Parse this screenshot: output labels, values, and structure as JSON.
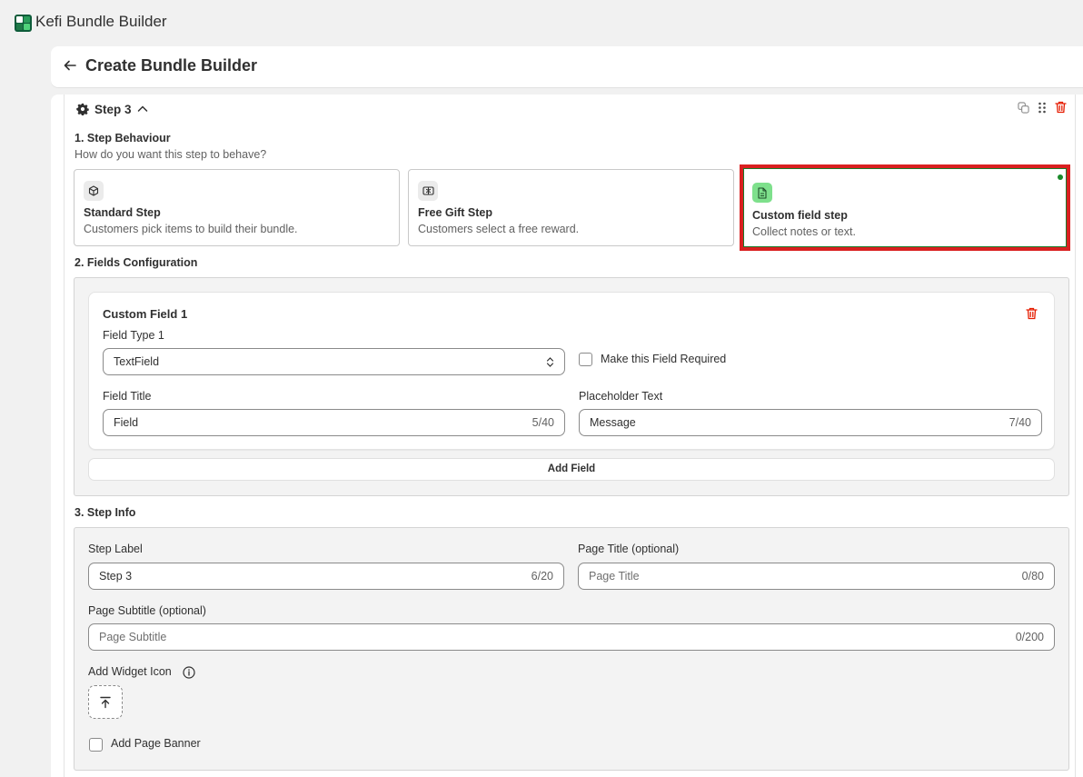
{
  "app": {
    "name": "Kefi Bundle Builder"
  },
  "header": {
    "title": "Create Bundle Builder"
  },
  "step": {
    "label": "Step 3",
    "behaviour": {
      "title": "1. Step Behaviour",
      "subtitle": "How do you want this step to behave?",
      "options": [
        {
          "title": "Standard Step",
          "desc": "Customers pick items to build their bundle.",
          "icon": "cube-icon"
        },
        {
          "title": "Free Gift Step",
          "desc": "Customers select a free reward.",
          "icon": "gift-icon"
        },
        {
          "title": "Custom field step",
          "desc": "Collect notes or text.",
          "icon": "document-icon",
          "selected": true
        }
      ]
    },
    "fields": {
      "title": "2. Fields Configuration",
      "custom_field": {
        "title": "Custom Field 1",
        "type_label": "Field Type 1",
        "type_value": "TextField",
        "required_label": "Make this Field Required",
        "field_title_label": "Field Title",
        "field_title_value": "Field",
        "field_title_count": "5/40",
        "placeholder_label": "Placeholder Text",
        "placeholder_value": "Message",
        "placeholder_count": "7/40"
      },
      "add_field_label": "Add Field"
    },
    "info": {
      "title": "3. Step Info",
      "step_label_label": "Step Label",
      "step_label_value": "Step 3",
      "step_label_count": "6/20",
      "page_title_label": "Page Title (optional)",
      "page_title_placeholder": "Page Title",
      "page_title_count": "0/80",
      "page_subtitle_label": "Page Subtitle (optional)",
      "page_subtitle_placeholder": "Page Subtitle",
      "page_subtitle_count": "0/200",
      "widget_icon_label": "Add Widget Icon",
      "page_banner_label": "Add Page Banner"
    }
  },
  "colors": {
    "accent_red": "#d92020",
    "selected_icon_bg": "#7ee08c",
    "delete_red": "#e51c00"
  }
}
